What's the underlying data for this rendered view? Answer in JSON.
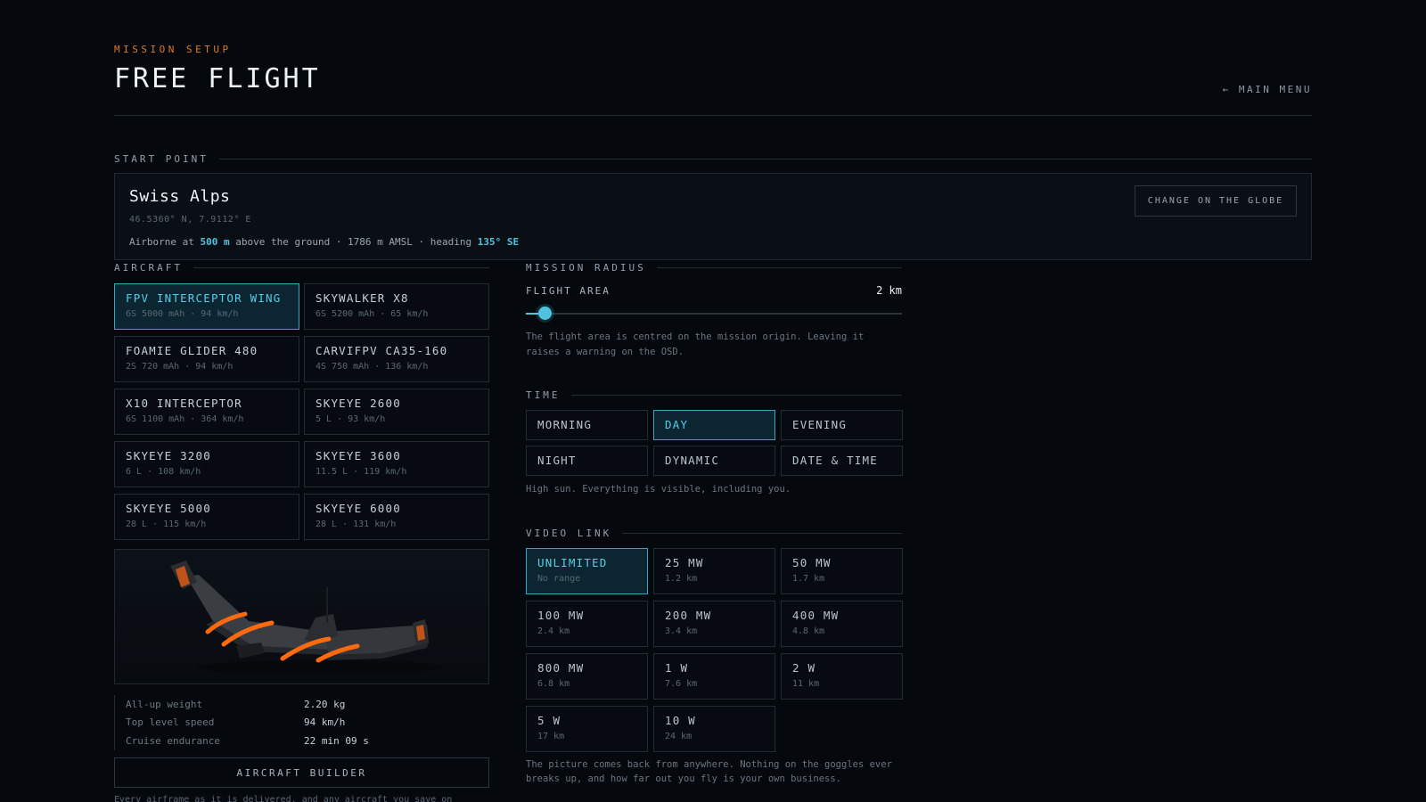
{
  "header": {
    "eyebrow": "MISSION SETUP",
    "title": "FREE FLIGHT",
    "main_menu": "← MAIN MENU"
  },
  "start_point": {
    "heading": "START POINT",
    "name": "Swiss Alps",
    "coords": "46.5360° N, 7.9112° E",
    "airborne_prefix": "Airborne at ",
    "altitude_agl": "500 m",
    "airborne_mid": " above the ground · 1786 m AMSL · heading ",
    "heading_val": "135° SE",
    "change_button": "CHANGE ON THE GLOBE"
  },
  "aircraft": {
    "heading": "AIRCRAFT",
    "selected_index": 0,
    "items": [
      {
        "name": "FPV INTERCEPTOR WING",
        "spec": "6S 5000 mAh · 94 km/h"
      },
      {
        "name": "SKYWALKER X8",
        "spec": "6S 5200 mAh · 65 km/h"
      },
      {
        "name": "FOAMIE GLIDER 480",
        "spec": "2S 720 mAh · 94 km/h"
      },
      {
        "name": "CARVIFPV CA35-160",
        "spec": "4S 750 mAh · 136 km/h"
      },
      {
        "name": "X10 INTERCEPTOR",
        "spec": "6S 1100 mAh · 364 km/h"
      },
      {
        "name": "SKYEYE 2600",
        "spec": "5 L · 93 km/h"
      },
      {
        "name": "SKYEYE 3200",
        "spec": "6 L · 108 km/h"
      },
      {
        "name": "SKYEYE 3600",
        "spec": "11.5 L · 119 km/h"
      },
      {
        "name": "SKYEYE 5000",
        "spec": "28 L · 115 km/h"
      },
      {
        "name": "SKYEYE 6000",
        "spec": "28 L · 131 km/h"
      }
    ],
    "stats": [
      {
        "label": "All-up weight",
        "value": "2.20 kg"
      },
      {
        "label": "Top level speed",
        "value": "94 km/h"
      },
      {
        "label": "Cruise endurance",
        "value": "22 min 09 s"
      }
    ],
    "builder_button": "AIRCRAFT BUILDER",
    "builder_note": "Every airframe as it is delivered, and any aircraft you save on"
  },
  "mission_radius": {
    "heading": "MISSION RADIUS",
    "label": "FLIGHT AREA",
    "value": "2 km",
    "slider_fraction": 0.05,
    "note": "The flight area is centred on the mission origin. Leaving it raises a warning on the OSD."
  },
  "time": {
    "heading": "TIME",
    "selected_index": 1,
    "options": [
      "MORNING",
      "DAY",
      "EVENING",
      "NIGHT",
      "DYNAMIC",
      "DATE & TIME"
    ],
    "note": "High sun. Everything is visible, including you."
  },
  "video_link": {
    "heading": "VIDEO LINK",
    "selected_index": 0,
    "options": [
      {
        "name": "UNLIMITED",
        "spec": "No range"
      },
      {
        "name": "25 MW",
        "spec": "1.2 km"
      },
      {
        "name": "50 MW",
        "spec": "1.7 km"
      },
      {
        "name": "100 MW",
        "spec": "2.4 km"
      },
      {
        "name": "200 MW",
        "spec": "3.4 km"
      },
      {
        "name": "400 MW",
        "spec": "4.8 km"
      },
      {
        "name": "800 MW",
        "spec": "6.8 km"
      },
      {
        "name": "1 W",
        "spec": "7.6 km"
      },
      {
        "name": "2 W",
        "spec": "11 km"
      },
      {
        "name": "5 W",
        "spec": "17 km"
      },
      {
        "name": "10 W",
        "spec": "24 km"
      }
    ],
    "note": "The picture comes back from anywhere. Nothing on the goggles ever breaks up, and how far out you fly is your own business."
  },
  "colors": {
    "accent": "#4fc3de",
    "eyebrow": "#e0782a",
    "wing_stripe": "#ff6a10"
  }
}
